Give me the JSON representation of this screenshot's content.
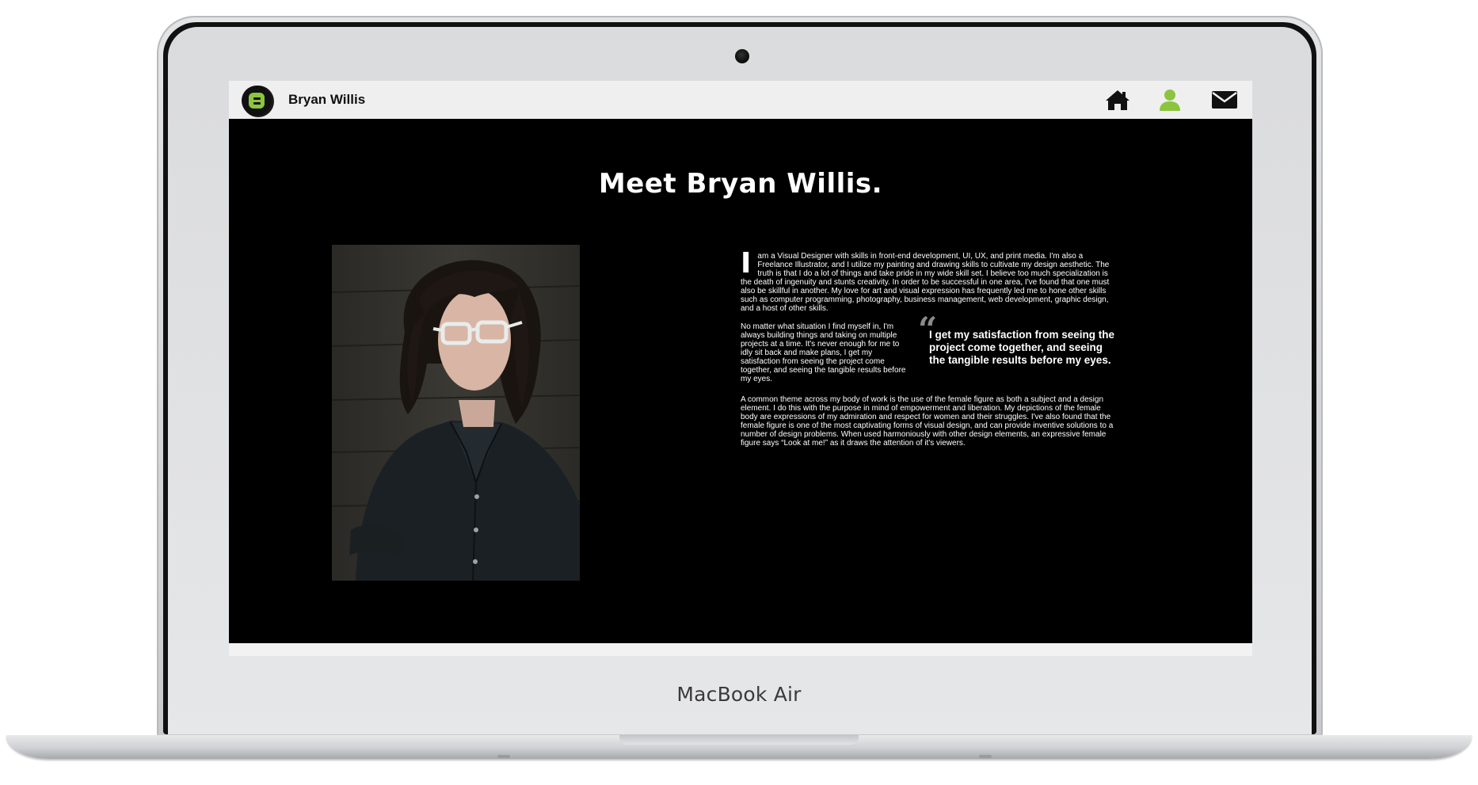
{
  "device": {
    "label": "MacBook Air"
  },
  "header": {
    "site_name": "Bryan Willis",
    "nav": [
      {
        "icon": "home-icon",
        "active": false
      },
      {
        "icon": "user-icon",
        "active": true
      },
      {
        "icon": "envelope-icon",
        "active": false
      }
    ],
    "accent_color": "#8bc53f"
  },
  "main": {
    "title": "Meet Bryan Willis.",
    "bio": {
      "drop_cap": "I",
      "para1": "am a Visual Designer with skills in front-end development, UI, UX, and print media. I'm also a Freelance Illustrator, and I utilize my painting and drawing skills to cultivate my design aesthetic. The truth is that I do a lot of things and take pride in my wide skill set. I believe too much specialization is the death of ingenuity and stunts creativity. In order to be successful in one area, I've found that one must also be skillful in another. My love for art and visual expression has frequently led me to hone other skills such as computer programming, photography, business management, web development, graphic design, and a host of other skills.",
      "para2": "No matter what situation I find myself in, I'm always building things and taking on multiple projects at a time. It's never enough for me to idly sit back and make plans, I get my satisfaction from seeing the project come together, and seeing the tangible results before my eyes.",
      "pull_quote_mark": "“",
      "pull_quote": "I get my satisfaction from seeing the project come together, and seeing the tangible results before my eyes.",
      "para3": "A common theme across my body of work is the use of the female figure as both a subject and a design element. I do this with the purpose in mind of empowerment and liberation. My depictions of the female body are expressions of my admiration and respect for women and their struggles. I've also found that the female figure is one of the most captivating forms of visual design, and can provide inventive solutions to a number of design problems. When used harmoniously with other design elements, an expressive female figure says “Look at me!” as it draws the attention of it's viewers."
    }
  }
}
